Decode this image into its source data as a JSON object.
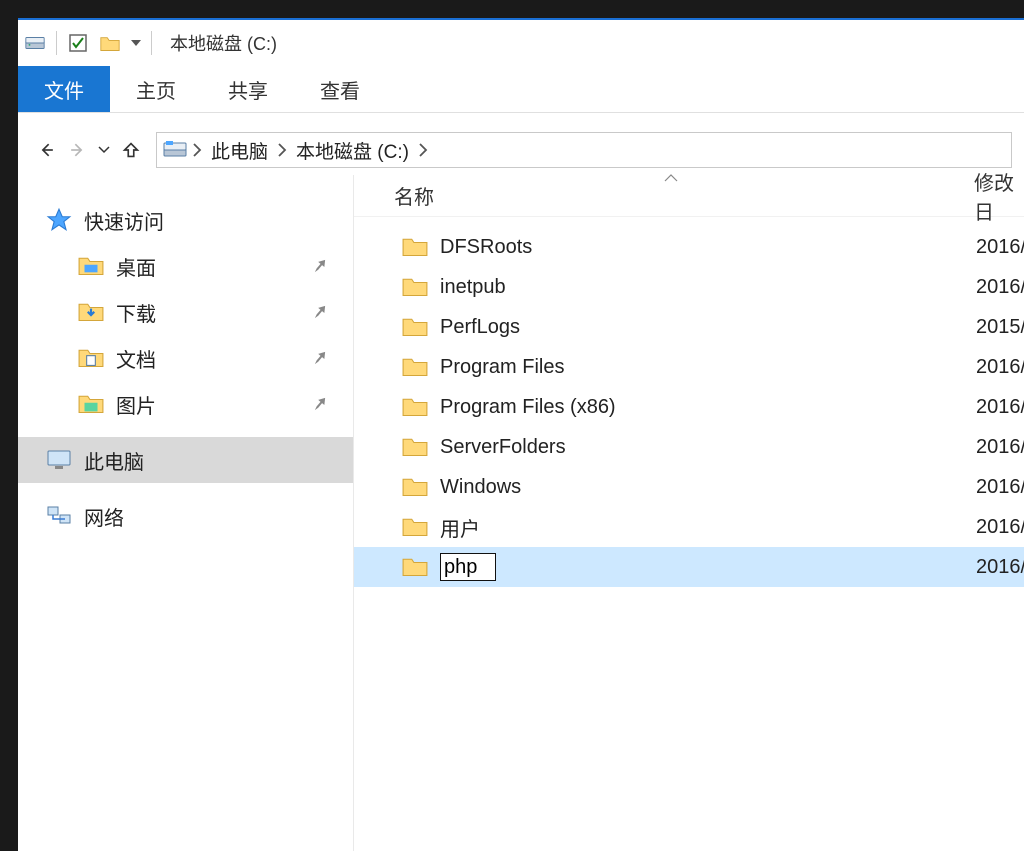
{
  "window_title": "本地磁盘 (C:)",
  "ribbon": {
    "file": "文件",
    "home": "主页",
    "share": "共享",
    "view": "查看"
  },
  "breadcrumb": {
    "this_pc": "此电脑",
    "local_disk": "本地磁盘 (C:)"
  },
  "columns": {
    "name": "名称",
    "date": "修改日"
  },
  "sidebar": {
    "quick_access": "快速访问",
    "desktop": "桌面",
    "downloads": "下载",
    "documents": "文档",
    "pictures": "图片",
    "this_pc": "此电脑",
    "network": "网络"
  },
  "files": [
    {
      "name": "DFSRoots",
      "date": "2016/"
    },
    {
      "name": "inetpub",
      "date": "2016/"
    },
    {
      "name": "PerfLogs",
      "date": "2015/"
    },
    {
      "name": "Program Files",
      "date": "2016/"
    },
    {
      "name": "Program Files (x86)",
      "date": "2016/"
    },
    {
      "name": "ServerFolders",
      "date": "2016/"
    },
    {
      "name": "Windows",
      "date": "2016/"
    },
    {
      "name": "用户",
      "date": "2016/"
    }
  ],
  "renaming": {
    "value": "php",
    "date": "2016/"
  }
}
